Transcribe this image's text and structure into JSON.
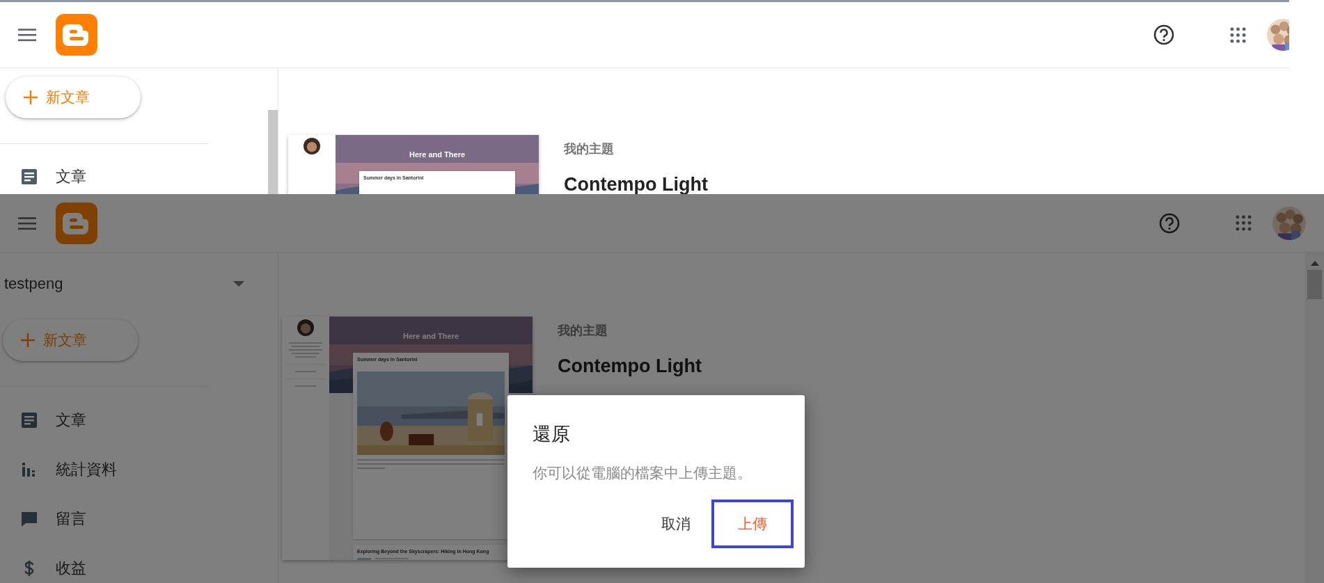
{
  "captures": [
    {
      "new_post": "新文章",
      "nav": [
        {
          "label": "文章",
          "kind": "posts"
        }
      ],
      "theme": {
        "section": "我的主題",
        "name": "Contempo Light",
        "preview": {
          "blog_title": "Here and There",
          "posts": [
            "Summer days in Santorini"
          ]
        }
      }
    },
    {
      "blog_name": "testpeng",
      "new_post": "新文章",
      "nav": [
        {
          "label": "文章",
          "kind": "posts"
        },
        {
          "label": "統計資料",
          "kind": "stats"
        },
        {
          "label": "留言",
          "kind": "comments"
        },
        {
          "label": "收益",
          "kind": "earnings"
        }
      ],
      "theme": {
        "section": "我的主題",
        "name": "Contempo Light",
        "preview": {
          "blog_title": "Here and There",
          "posts": [
            "Summer days in Santorini",
            "Exploring Beyond the Skyscrapers: Hiking in Hong Kong"
          ]
        }
      },
      "dialog": {
        "title": "還原",
        "message": "你可以從電腦的檔案中上傳主題。",
        "buttons": [
          {
            "label": "取消",
            "kind": "default",
            "highlighted": false
          },
          {
            "label": "上傳",
            "kind": "primary",
            "highlighted": true
          }
        ]
      }
    }
  ]
}
